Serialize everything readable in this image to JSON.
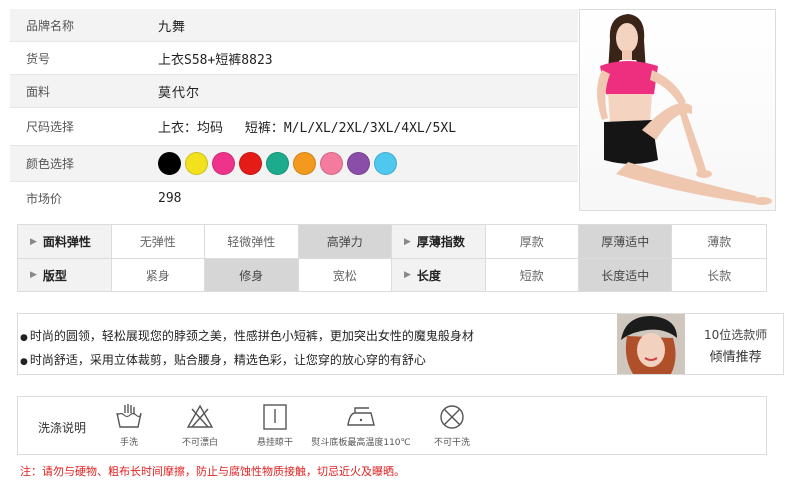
{
  "product_info": {
    "brand_label": "品牌名称",
    "brand_value": "九舞",
    "item_no_label": "货号",
    "item_no_value": "上衣S58+短裤8823",
    "fabric_label": "面料",
    "fabric_value": "莫代尔",
    "size_label": "尺码选择",
    "size_top": "上衣：均码",
    "size_shorts": "短裤：M/L/XL/2XL/3XL/4XL/5XL",
    "color_label": "颜色选择",
    "colors": [
      "#000000",
      "#f2e21e",
      "#f0338a",
      "#e41b17",
      "#1cab8c",
      "#f39a1e",
      "#f47a9e",
      "#8b4ea8",
      "#4fc8f0"
    ],
    "price_label": "市场价",
    "price_value": "298"
  },
  "attributes": {
    "row1": [
      {
        "text": "面料弹性",
        "kind": "head"
      },
      {
        "text": "无弹性",
        "kind": "opt"
      },
      {
        "text": "轻微弹性",
        "kind": "opt"
      },
      {
        "text": "高弹力",
        "kind": "on"
      },
      {
        "text": "厚薄指数",
        "kind": "head"
      },
      {
        "text": "厚款",
        "kind": "opt"
      },
      {
        "text": "厚薄适中",
        "kind": "on"
      },
      {
        "text": "薄款",
        "kind": "opt"
      }
    ],
    "row2": [
      {
        "text": "版型",
        "kind": "head"
      },
      {
        "text": "紧身",
        "kind": "opt"
      },
      {
        "text": "修身",
        "kind": "on"
      },
      {
        "text": "宽松",
        "kind": "opt"
      },
      {
        "text": "长度",
        "kind": "head"
      },
      {
        "text": "短款",
        "kind": "opt"
      },
      {
        "text": "长度适中",
        "kind": "on"
      },
      {
        "text": "长款",
        "kind": "opt"
      }
    ]
  },
  "description": {
    "line1": "时尚的圆领，轻松展现您的脖颈之美，性感拼色小短裤，更加突出女性的魔鬼般身材",
    "line2": "时尚舒适，采用立体裁剪，贴合腰身，精选色彩，让您穿的放心穿的有舒心",
    "recommend_top": "10位选款师",
    "recommend_bottom": "倾情推荐"
  },
  "care": {
    "title": "洗涤说明",
    "items": [
      {
        "icon": "hand-wash-icon",
        "label": "手洗"
      },
      {
        "icon": "no-bleach-icon",
        "label": "不可漂白"
      },
      {
        "icon": "hang-dry-icon",
        "label": "悬挂晾干"
      },
      {
        "icon": "iron-icon",
        "label": "熨斗底板最高温度110℃"
      },
      {
        "icon": "no-dry-clean-icon",
        "label": "不可干洗"
      }
    ]
  },
  "warning": "注：请勿与硬物、粗布长时间摩擦，防止与腐蚀性物质接触，切忌近火及曝晒。"
}
